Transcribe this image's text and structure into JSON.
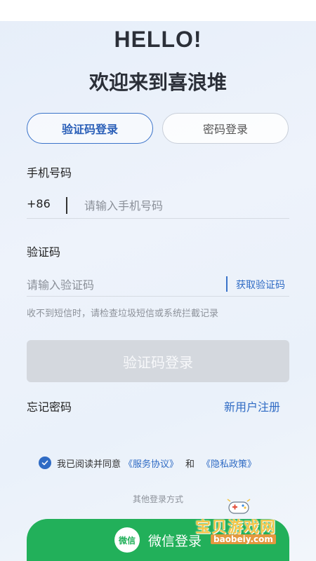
{
  "header": {
    "greeting": "HELLO!",
    "welcome": "欢迎来到喜浪堆"
  },
  "tabs": [
    {
      "label": "验证码登录",
      "active": true
    },
    {
      "label": "密码登录",
      "active": false
    }
  ],
  "phone": {
    "label": "手机号码",
    "prefix": "+86",
    "placeholder": "请输入手机号码",
    "value": ""
  },
  "code": {
    "label": "验证码",
    "placeholder": "请输入验证码",
    "value": "",
    "get_code": "获取验证码"
  },
  "hint": "收不到短信时，请检查垃圾短信或系统拦截记录",
  "login_button": "验证码登录",
  "links": {
    "forgot": "忘记密码",
    "register": "新用户注册"
  },
  "agreement": {
    "checked": true,
    "prefix": "我已阅读并同意",
    "service": "《服务协议》",
    "and": "和",
    "privacy": "《隐私政策》"
  },
  "other_login": "其他登录方式",
  "wechat": {
    "icon_text": "微信",
    "label": "微信登录"
  },
  "watermark": {
    "name": "宝贝游戏网",
    "url": "baobeiy.com"
  },
  "colors": {
    "accent": "#2f6bc4",
    "wechat_green": "#22b05a",
    "disabled_button": "#d4d8de"
  }
}
